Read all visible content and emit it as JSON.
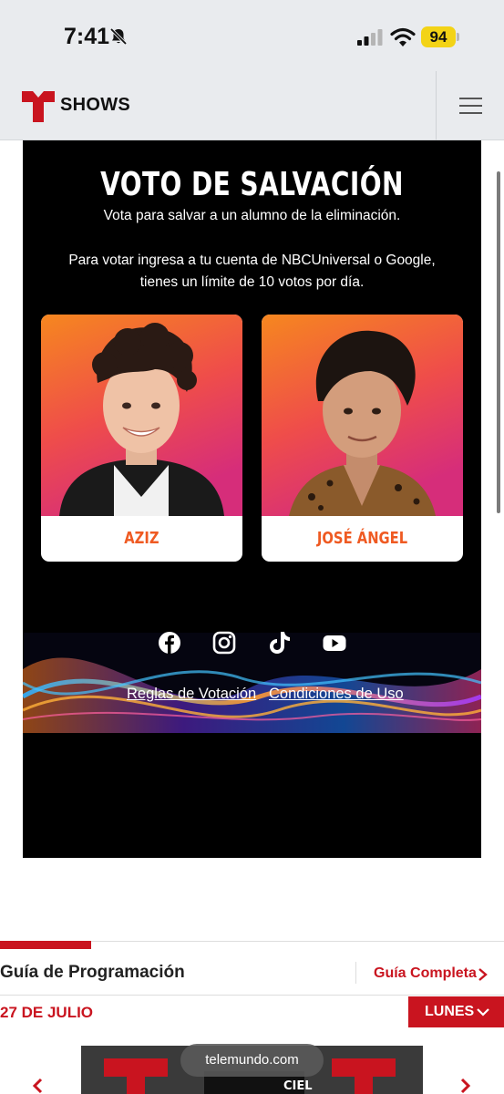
{
  "status_bar": {
    "time": "7:41",
    "battery": "94"
  },
  "header": {
    "brand": "SHOWS"
  },
  "vote": {
    "title": "VOTO DE SALVACIÓN",
    "subtitle": "Vota para salvar a un alumno de la eliminación.",
    "instructions": "Para votar ingresa a tu cuenta de NBCUniversal o Google, tienes un límite de 10 votos por día.",
    "candidates": [
      {
        "name": "AZIZ"
      },
      {
        "name": "JOSÉ ÁNGEL"
      }
    ],
    "social": [
      "facebook-icon",
      "instagram-icon",
      "tiktok-icon",
      "youtube-icon"
    ],
    "links": {
      "rules": "Reglas de Votación",
      "terms": "Condiciones de Uso"
    }
  },
  "guide": {
    "title": "Guía de Programación",
    "full_link": "Guía Completa",
    "date": "27 DE JULIO",
    "day": "LUNES"
  },
  "browser": {
    "url": "telemundo.com"
  },
  "colors": {
    "brand_red": "#c9141f",
    "accent_orange": "#ef5a22",
    "panel_bg": "#000000",
    "battery": "#f3d316"
  }
}
